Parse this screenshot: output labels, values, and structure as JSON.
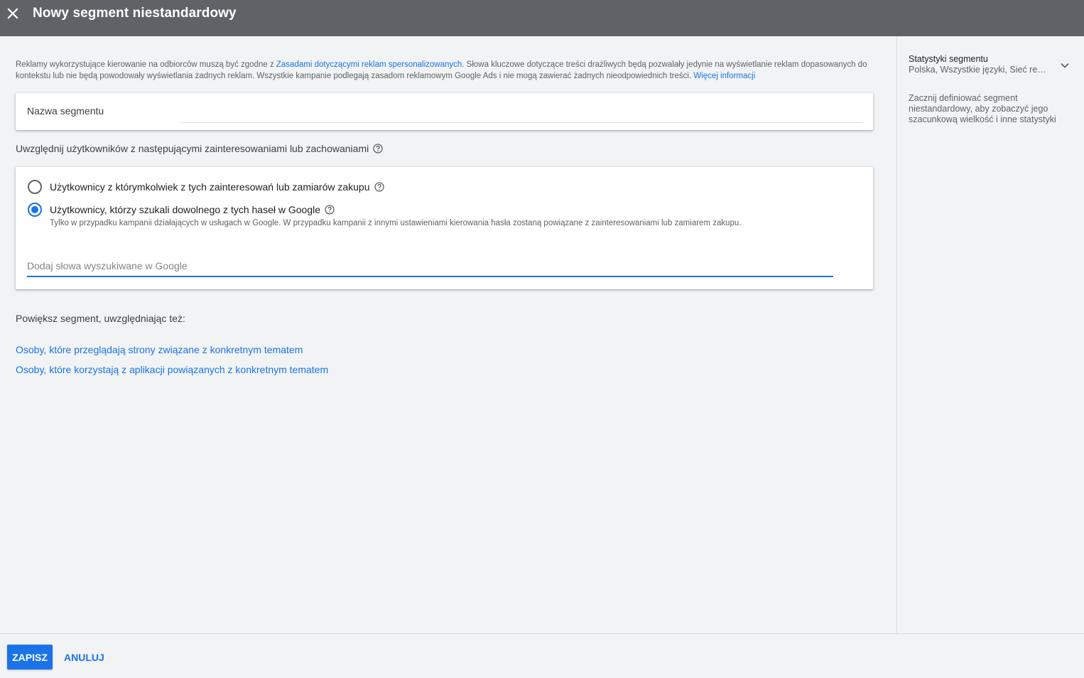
{
  "header": {
    "title": "Nowy segment niestandardowy",
    "close_icon": "close-icon"
  },
  "policy": {
    "text_1": "Reklamy wykorzystujące kierowanie na odbiorców muszą być zgodne z ",
    "link_1": "Zasadami dotyczącymi reklam spersonalizowanych",
    "text_2": ". Słowa kluczowe dotyczące treści drażliwych będą pozwalały jedynie na wyświetlanie reklam dopasowanych do kontekstu lub nie będą powodowały wyświetlania żadnych reklam. Wszystkie kampanie podlegają zasadom reklamowym Google Ads i nie mogą zawierać żadnych nieodpowiednich treści. ",
    "link_2": "Więcej informacji"
  },
  "segment_name": {
    "label": "Nazwa segmentu",
    "value": ""
  },
  "include": {
    "label": "Uwzględnij użytkowników z następującymi zainteresowaniami lub zachowaniami",
    "options": [
      {
        "label": "Użytkownicy z którymkolwiek z tych zainteresowań lub zamiarów zakupu",
        "checked": false
      },
      {
        "label": "Użytkownicy, którzy szukali dowolnego z tych haseł w Google",
        "checked": true
      }
    ],
    "note": "Tylko w przypadku kampanii działających w usługach w Google. W przypadku kampanii z innymi ustawieniami kierowania hasła zostaną powiązane z zainteresowaniami lub zamiarem zakupu.",
    "keyword_placeholder": "Dodaj słowa wyszukiwane w Google"
  },
  "expand": {
    "label": "Powiększ segment, uwzględniając też:",
    "links": [
      "Osoby, które przeglądają strony związane z konkretnym tematem",
      "Osoby, które korzystają z aplikacji powiązanych z konkretnym tematem"
    ]
  },
  "stats": {
    "title": "Statystyki segmentu",
    "subtitle": "Polska, Wszystkie języki, Sieć rekl…",
    "body": "Zacznij definiować segment niestandardowy, aby zobaczyć jego szacunkową wielkość i inne statystyki"
  },
  "footer": {
    "save_label": "ZAPISZ",
    "cancel_label": "ANULUJ"
  },
  "colors": {
    "header_bg": "#5f6368",
    "accent": "#1a73e8",
    "page_bg": "#f1f3f4"
  }
}
